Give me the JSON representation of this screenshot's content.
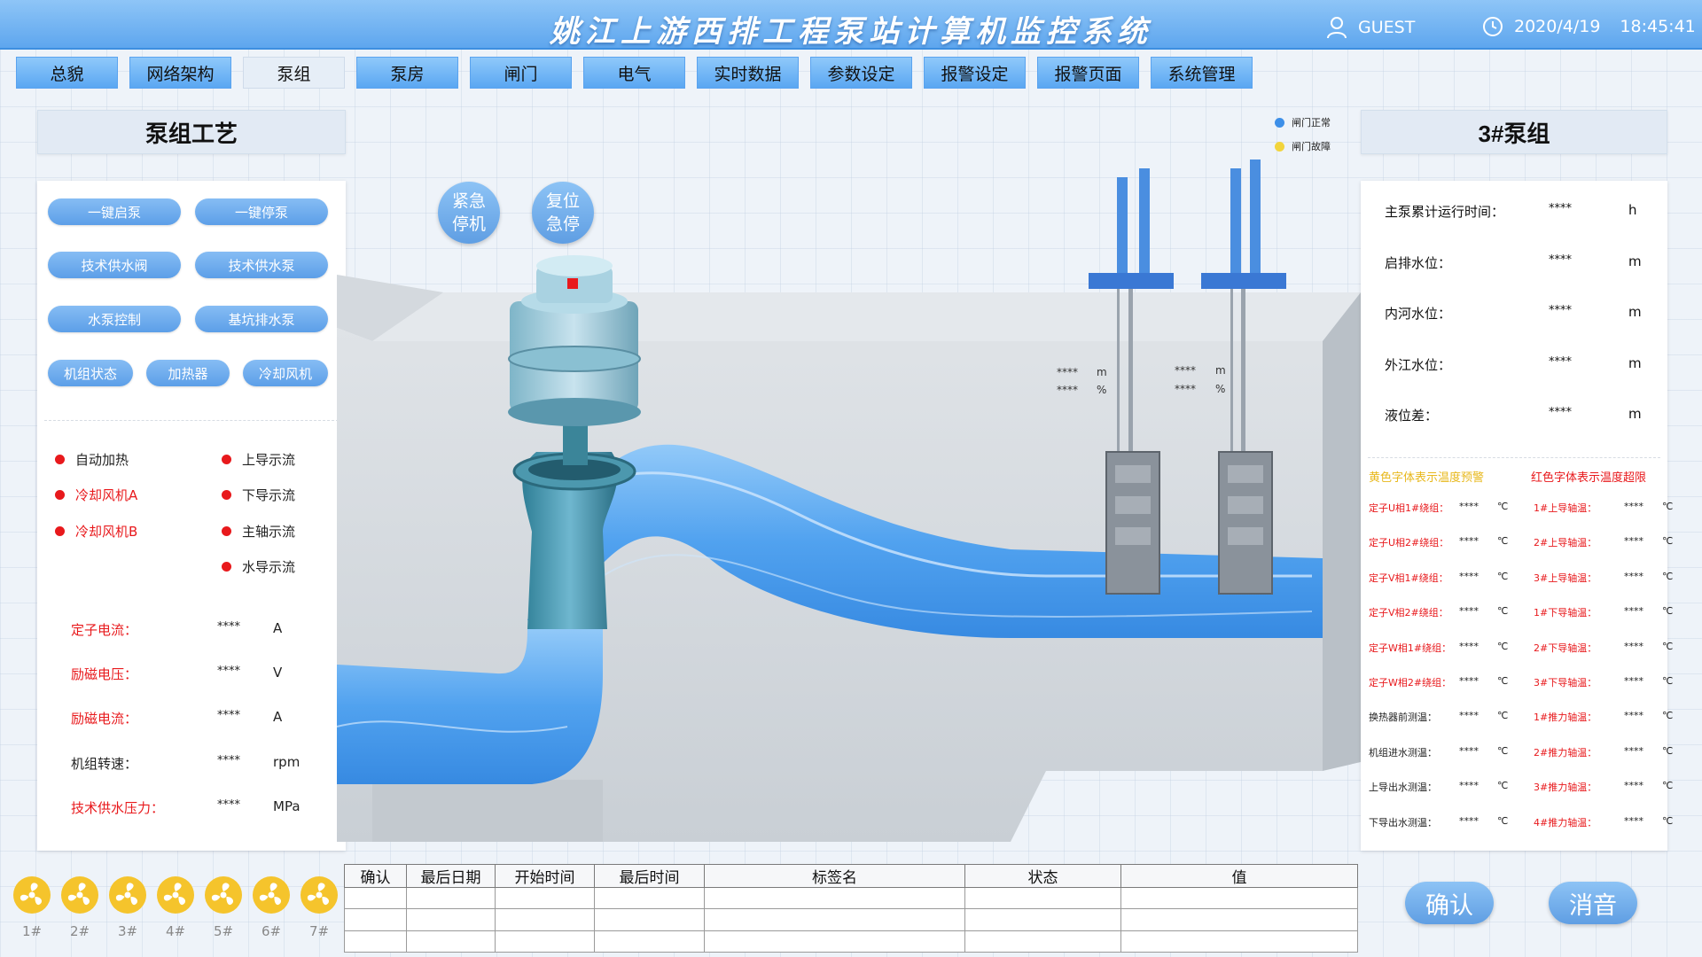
{
  "header": {
    "title": "姚江上游西排工程泵站计算机监控系统",
    "user": "GUEST",
    "date": "2020/4/19",
    "time": "18:45:41",
    "user_icon": "user-icon",
    "clock_icon": "clock-icon"
  },
  "nav": {
    "items": [
      "总貌",
      "网络架构",
      "泵组",
      "泵房",
      "闸门",
      "电气",
      "实时数据",
      "参数设定",
      "报警设定",
      "报警页面",
      "系统管理"
    ],
    "active": "泵组"
  },
  "left": {
    "title": "泵组工艺",
    "buttons": [
      "一键启泵",
      "一键停泵",
      "技术供水阀",
      "技术供水泵",
      "水泵控制",
      "基坑排水泵",
      "机组状态",
      "加热器",
      "冷却风机"
    ],
    "indicators_left": [
      "自动加热",
      "冷却风机A",
      "冷却风机B"
    ],
    "indicators_right": [
      "上导示流",
      "下导示流",
      "主轴示流",
      "水导示流"
    ],
    "measurements": [
      {
        "label": "定子电流：",
        "value": "****",
        "unit": "A"
      },
      {
        "label": "励磁电压：",
        "value": "****",
        "unit": "V"
      },
      {
        "label": "励磁电流：",
        "value": "****",
        "unit": "A"
      },
      {
        "label": "机组转速：",
        "value": "****",
        "unit": "rpm"
      },
      {
        "label": "技术供水压力：",
        "value": "****",
        "unit": "MPa"
      }
    ]
  },
  "center": {
    "estop": "紧急停机",
    "reset": "复位急停",
    "legend": [
      {
        "label": "闸门正常",
        "color": "#3d8fe8"
      },
      {
        "label": "闸门故障",
        "color": "#f2d43c"
      }
    ],
    "gates": [
      {
        "value1": "****",
        "unit1": "m",
        "value2": "****",
        "unit2": "%"
      },
      {
        "value1": "****",
        "unit1": "m",
        "value2": "****",
        "unit2": "%"
      }
    ]
  },
  "right": {
    "title": "3#泵组",
    "rows": [
      {
        "label": "主泵累计运行时间：",
        "value": "****",
        "unit": "h"
      },
      {
        "label": "启排水位：",
        "value": "****",
        "unit": "m"
      },
      {
        "label": "内河水位：",
        "value": "****",
        "unit": "m"
      },
      {
        "label": "外江水位：",
        "value": "****",
        "unit": "m"
      },
      {
        "label": "液位差：",
        "value": "****",
        "unit": "m"
      }
    ],
    "legend_warning": "黄色字体表示温度预警",
    "legend_alarm": "红色字体表示温度超限",
    "temps_left": [
      {
        "label": "定子U相1#绕组：",
        "value": "****",
        "unit": "℃"
      },
      {
        "label": "定子U相2#绕组：",
        "value": "****",
        "unit": "℃"
      },
      {
        "label": "定子V相1#绕组：",
        "value": "****",
        "unit": "℃"
      },
      {
        "label": "定子V相2#绕组：",
        "value": "****",
        "unit": "℃"
      },
      {
        "label": "定子W相1#绕组：",
        "value": "****",
        "unit": "℃"
      },
      {
        "label": "定子W相2#绕组：",
        "value": "****",
        "unit": "℃"
      },
      {
        "label": "换热器前测温：",
        "value": "****",
        "unit": "℃"
      },
      {
        "label": "机组进水测温：",
        "value": "****",
        "unit": "℃"
      },
      {
        "label": "上导出水测温：",
        "value": "****",
        "unit": "℃"
      },
      {
        "label": "下导出水测温：",
        "value": "****",
        "unit": "℃"
      }
    ],
    "temps_right": [
      {
        "label": "1#上导轴温：",
        "value": "****",
        "unit": "℃"
      },
      {
        "label": "2#上导轴温：",
        "value": "****",
        "unit": "℃"
      },
      {
        "label": "3#上导轴温：",
        "value": "****",
        "unit": "℃"
      },
      {
        "label": "1#下导轴温：",
        "value": "****",
        "unit": "℃"
      },
      {
        "label": "2#下导轴温：",
        "value": "****",
        "unit": "℃"
      },
      {
        "label": "3#下导轴温：",
        "value": "****",
        "unit": "℃"
      },
      {
        "label": "1#推力轴温：",
        "value": "****",
        "unit": "℃"
      },
      {
        "label": "2#推力轴温：",
        "value": "****",
        "unit": "℃"
      },
      {
        "label": "3#推力轴温：",
        "value": "****",
        "unit": "℃"
      },
      {
        "label": "4#推力轴温：",
        "value": "****",
        "unit": "℃"
      }
    ]
  },
  "bottom": {
    "fans": [
      "1#",
      "2#",
      "3#",
      "4#",
      "5#",
      "6#",
      "7#"
    ],
    "fan_icon": "fan-icon",
    "table_headers": [
      "确认",
      "最后日期",
      "开始时间",
      "最后时间",
      "标签名",
      "状态",
      "值"
    ],
    "confirm": "确认",
    "silence": "消音"
  },
  "colors": {
    "accent": "#5ea6ee",
    "alarm_red": "#e8191c",
    "water_blue": "#4d9ff0",
    "fan_yellow": "#f5c42c"
  }
}
